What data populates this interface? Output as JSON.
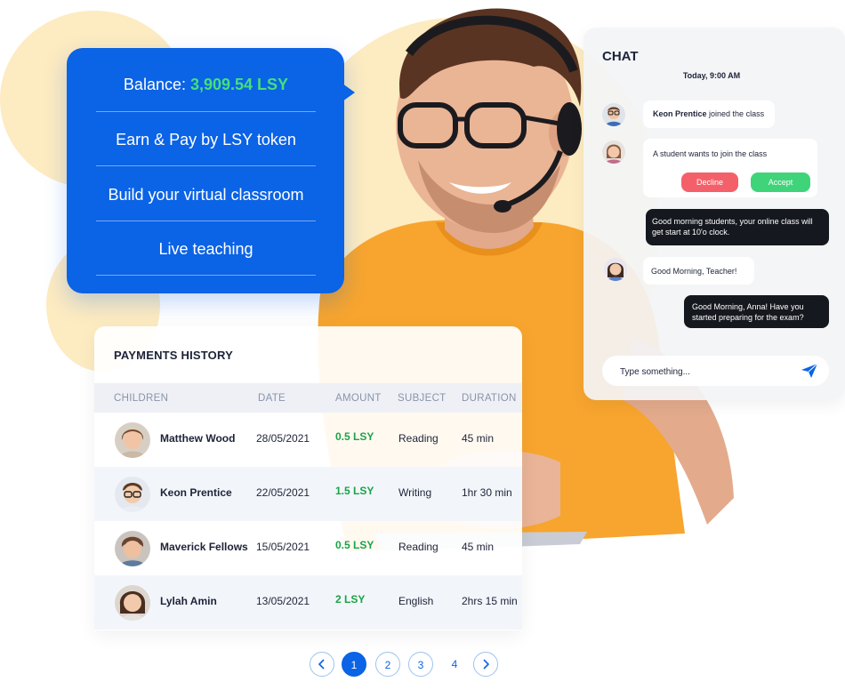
{
  "info_card": {
    "balance_label": "Balance: ",
    "balance_value": "3,909.54 LSY",
    "items": [
      "Earn & Pay by LSY token",
      "Build your virtual classroom",
      "Live teaching"
    ]
  },
  "chat": {
    "title": "CHAT",
    "date": "Today, 9:00 AM",
    "join_name": "Keon Prentice",
    "join_text": " joined the class",
    "request_text": "A student wants to join the class",
    "decline_label": "Decline",
    "accept_label": "Accept",
    "teacher_message": "Good morning students, your online class will get start at 10'o clock.",
    "student_reply": "Good Morning, Teacher!",
    "teacher_reply": "Good Morning, Anna! Have you started preparing for the exam?",
    "input_placeholder": "Type something...",
    "send_icon": "send-icon"
  },
  "payments": {
    "title": "PAYMENTS HISTORY",
    "columns": [
      "CHILDREN",
      "DATE",
      "AMOUNT",
      "SUBJECT",
      "DURATION"
    ],
    "rows": [
      {
        "name": "Matthew Wood",
        "date": "28/05/2021",
        "amount": "0.5 LSY",
        "subject": "Reading",
        "duration": "45 min"
      },
      {
        "name": "Keon Prentice",
        "date": "22/05/2021",
        "amount": "1.5 LSY",
        "subject": "Writing",
        "duration": "1hr 30 min"
      },
      {
        "name": "Maverick Fellows",
        "date": "15/05/2021",
        "amount": "0.5 LSY",
        "subject": "Reading",
        "duration": "45 min"
      },
      {
        "name": "Lylah Amin",
        "date": "13/05/2021",
        "amount": "2 LSY",
        "subject": "English",
        "duration": "2hrs 15 min"
      }
    ]
  },
  "pagination": {
    "pages": [
      "1",
      "2",
      "3",
      "4"
    ],
    "current": "1"
  },
  "colors": {
    "accent": "#0b63e5",
    "balance": "#44e07a",
    "amount": "#1aa347",
    "decline": "#f4606a",
    "accept": "#3fd47a",
    "blob": "#fdebc1",
    "shirt": "#f7a52e"
  }
}
